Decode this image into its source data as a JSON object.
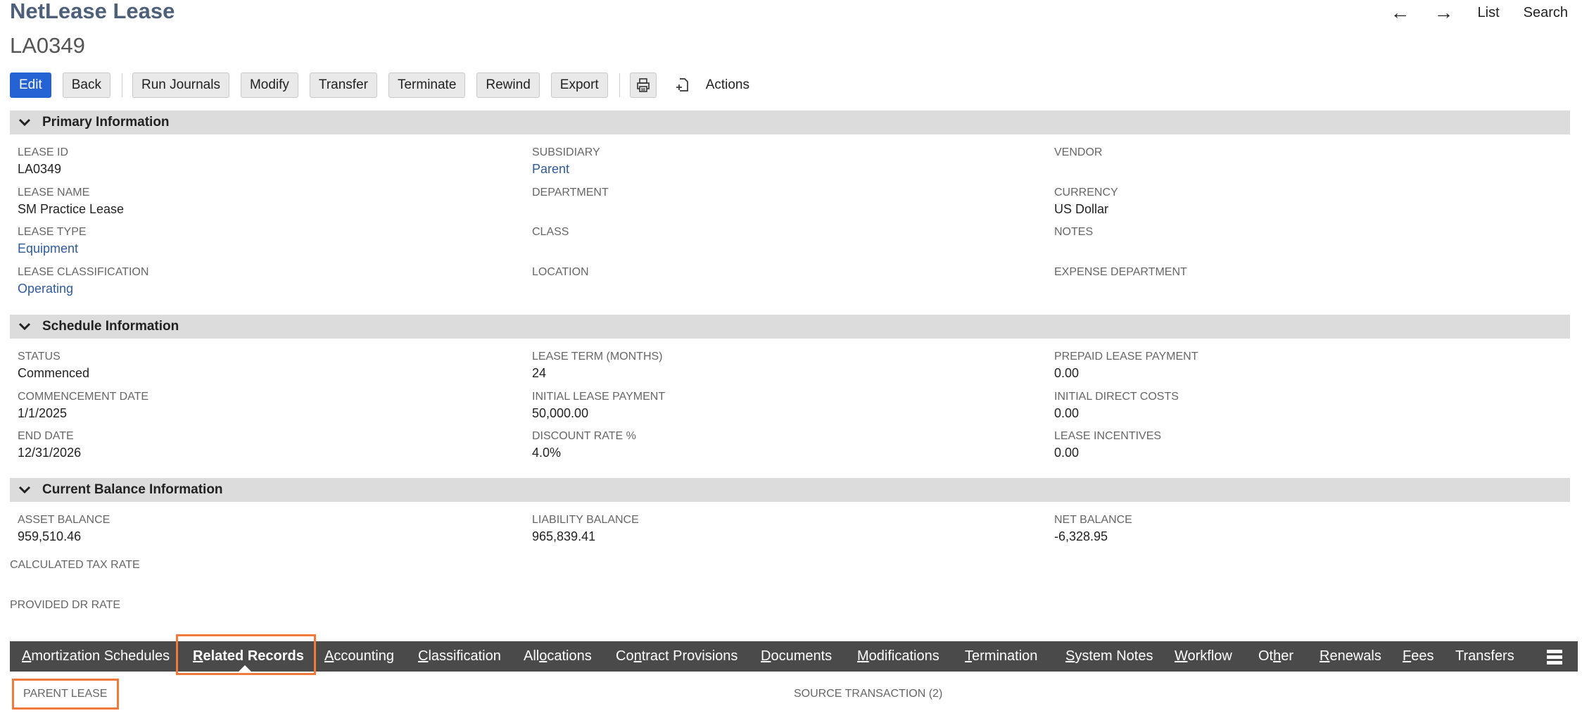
{
  "header": {
    "record_type": "NetLease Lease",
    "record_id": "LA0349",
    "nav": {
      "back_arrow": "←",
      "forward_arrow": "→",
      "list": "List",
      "search": "Search"
    }
  },
  "toolbar": {
    "edit": "Edit",
    "back": "Back",
    "run_journals": "Run Journals",
    "modify": "Modify",
    "transfer": "Transfer",
    "terminate": "Terminate",
    "rewind": "Rewind",
    "export": "Export",
    "actions": "Actions",
    "print_icon": "printer-icon",
    "new_icon": "new-document-icon"
  },
  "primary": {
    "title": "Primary Information",
    "lease_id_label": "LEASE ID",
    "lease_id": "LA0349",
    "subsidiary_label": "SUBSIDIARY",
    "subsidiary": "Parent",
    "vendor_label": "VENDOR",
    "lease_name_label": "LEASE NAME",
    "lease_name": "SM Practice Lease",
    "department_label": "DEPARTMENT",
    "currency_label": "CURRENCY",
    "currency": "US Dollar",
    "lease_type_label": "LEASE TYPE",
    "lease_type": "Equipment",
    "class_label": "CLASS",
    "notes_label": "NOTES",
    "lease_classification_label": "LEASE CLASSIFICATION",
    "lease_classification": "Operating",
    "location_label": "LOCATION",
    "expense_department_label": "EXPENSE DEPARTMENT"
  },
  "schedule": {
    "title": "Schedule Information",
    "status_label": "STATUS",
    "status": "Commenced",
    "lease_term_label": "LEASE TERM (MONTHS)",
    "lease_term": "24",
    "prepaid_label": "PREPAID LEASE PAYMENT",
    "prepaid": "0.00",
    "commencement_label": "COMMENCEMENT DATE",
    "commencement": "1/1/2025",
    "initial_payment_label": "INITIAL LEASE PAYMENT",
    "initial_payment": "50,000.00",
    "initial_direct_label": "INITIAL DIRECT COSTS",
    "initial_direct": "0.00",
    "end_date_label": "END DATE",
    "end_date": "12/31/2026",
    "discount_label": "DISCOUNT RATE %",
    "discount": "4.0%",
    "incentives_label": "LEASE INCENTIVES",
    "incentives": "0.00"
  },
  "balance": {
    "title": "Current Balance Information",
    "asset_label": "ASSET BALANCE",
    "asset": "959,510.46",
    "liability_label": "LIABILITY BALANCE",
    "liability": "965,839.41",
    "net_label": "NET BALANCE",
    "net": "-6,328.95"
  },
  "misc": {
    "calculated_tax_rate_label": "CALCULATED TAX RATE",
    "provided_dr_rate_label": "PROVIDED DR RATE"
  },
  "tabs": [
    {
      "label": "Amortization Schedules",
      "ul": "A",
      "rest": "mortization Schedules"
    },
    {
      "label": "Related Records",
      "ul": "R",
      "rest": "elated Records"
    },
    {
      "label": "Accounting",
      "ul": "A",
      "rest": "ccounting"
    },
    {
      "label": "Classification",
      "ul": "C",
      "rest": "lassification"
    },
    {
      "label": "Allocations",
      "pre": "All",
      "ul": "o",
      "rest": "cations"
    },
    {
      "label": "Contract Provisions",
      "pre": "Co",
      "ul": "n",
      "rest": "tract Provisions"
    },
    {
      "label": "Documents",
      "ul": "D",
      "rest": "ocuments"
    },
    {
      "label": "Modifications",
      "ul": "M",
      "rest": "odifications"
    },
    {
      "label": "Termination",
      "ul": "T",
      "rest": "ermination"
    },
    {
      "label": "System Notes",
      "ul": "S",
      "rest": "ystem Notes"
    },
    {
      "label": "Workflow",
      "ul": "W",
      "rest": "orkflow"
    },
    {
      "label": "Other",
      "pre": "Ot",
      "ul": "h",
      "rest": "er"
    },
    {
      "label": "Renewals",
      "ul": "R",
      "rest": "enewals"
    },
    {
      "label": "Fees",
      "ul": "F",
      "rest": "ees"
    },
    {
      "label": "Transfers",
      "ul": "",
      "rest": "Transfers"
    }
  ],
  "related": {
    "parent_lease_label": "PARENT LEASE",
    "source_transaction_label": "SOURCE TRANSACTION (2)"
  },
  "highlight_color": "#ef7a3c"
}
